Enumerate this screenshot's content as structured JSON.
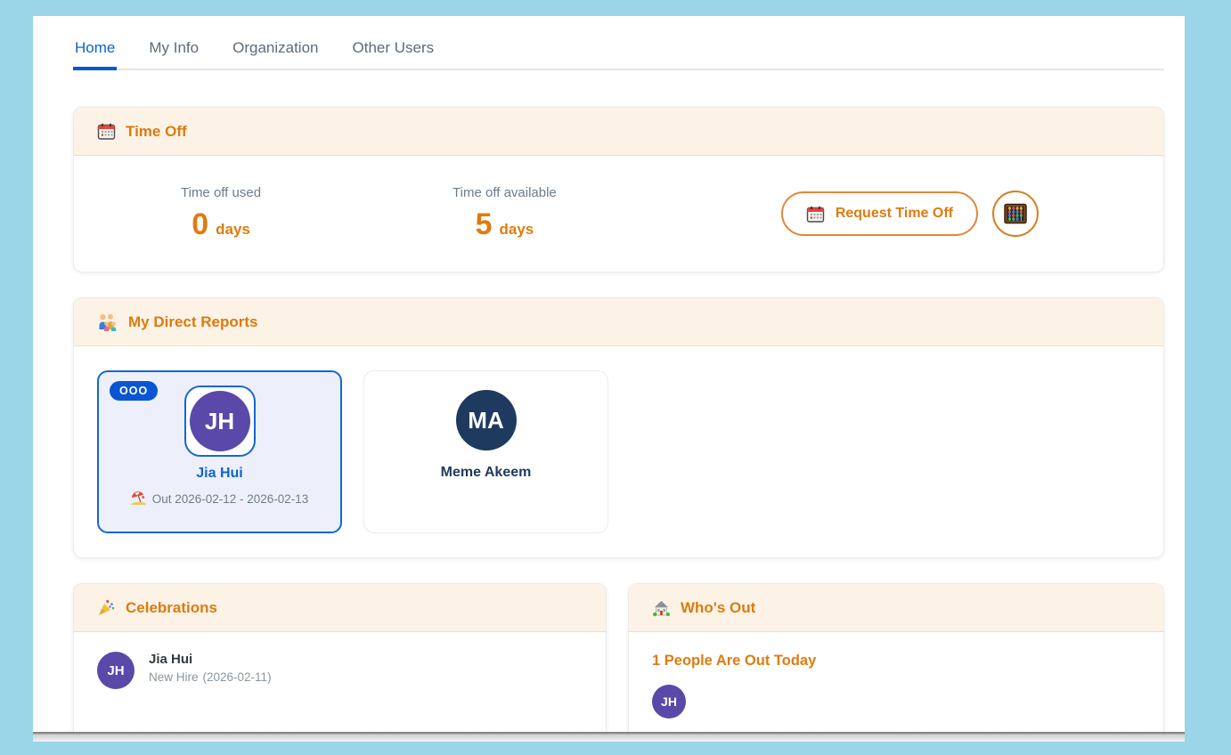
{
  "tabs": [
    {
      "label": "Home",
      "active": true
    },
    {
      "label": "My Info",
      "active": false
    },
    {
      "label": "Organization",
      "active": false
    },
    {
      "label": "Other Users",
      "active": false
    }
  ],
  "time_off": {
    "title": "Time Off",
    "icon": "calendar-icon",
    "stats": [
      {
        "label": "Time off used",
        "value": "0",
        "unit": "days"
      },
      {
        "label": "Time off available",
        "value": "5",
        "unit": "days"
      }
    ],
    "request_button": {
      "label": "Request Time Off",
      "icon": "calendar-icon"
    },
    "balance_button": {
      "icon": "abacus-icon"
    }
  },
  "direct_reports": {
    "title": "My Direct Reports",
    "icon": "family-icon",
    "cards": [
      {
        "initials": "JH",
        "name": "Jia Hui",
        "badge": "OOO",
        "status_icon": "beach-umbrella-icon",
        "status": "Out 2026-02-12 - 2026-02-13",
        "avatar_color": "#5a49a8",
        "name_color": "#1163d2"
      },
      {
        "initials": "MA",
        "name": "Meme Akeem",
        "avatar_color": "#1f3a5f",
        "name_color": "#1e3a5e"
      }
    ]
  },
  "celebrations": {
    "title": "Celebrations",
    "icon": "party-popper-icon",
    "items": [
      {
        "initials": "JH",
        "name": "Jia Hui",
        "event": "New Hire",
        "date": "(2026-02-11)",
        "avatar_color": "#5a49a8"
      }
    ]
  },
  "whos_out": {
    "title": "Who's Out",
    "icon": "house-icon",
    "headline": "1 People Are Out Today",
    "people": [
      {
        "initials": "JH",
        "avatar_color": "#5a49a8"
      }
    ]
  },
  "colors": {
    "page_background": "#9ad6e8",
    "accent_orange": "#df7b10",
    "header_peach": "#fcf3e6",
    "active_tab_blue": "#0d62d0",
    "ooo_badge_blue": "#0a55d5",
    "highlight_tile_border": "#1566d8",
    "highlight_tile_bg": "#edf0fb"
  }
}
